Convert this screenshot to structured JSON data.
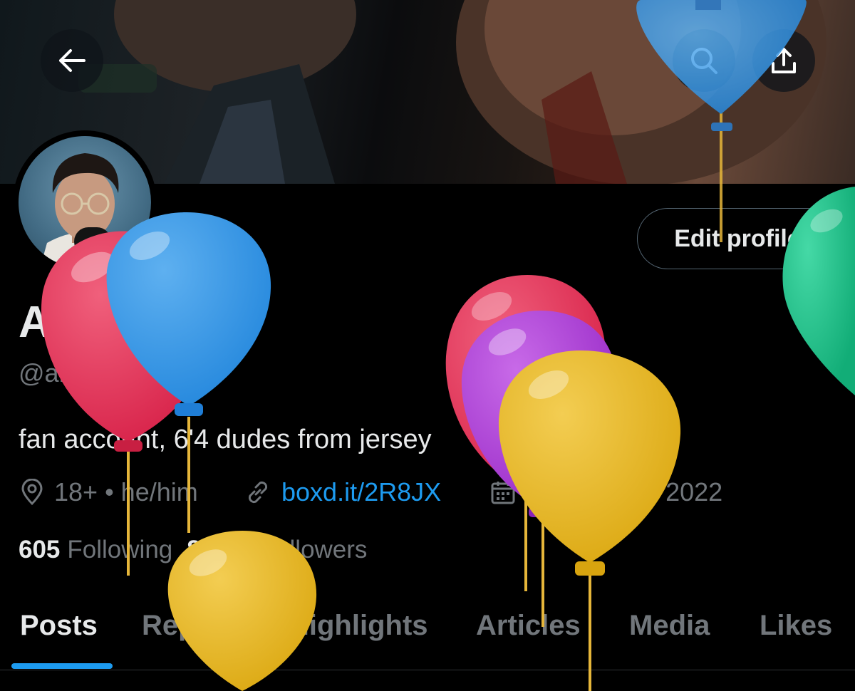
{
  "header": {
    "back_icon": "arrow-left-icon",
    "search_icon": "search-icon",
    "share_icon": "share-icon"
  },
  "profile": {
    "display_name": "Anti",
    "handle": "@antipike",
    "edit_button_label": "Edit profile",
    "bio": "fan account, 6'4 dudes from jersey",
    "location": "18+ • he/him",
    "website": "boxd.it/2R8JX",
    "joined": "Joined April 2022"
  },
  "stats": {
    "following_count": "605",
    "following_label": "Following",
    "followers_count": "82.9K",
    "followers_label": "Followers"
  },
  "tabs": [
    {
      "label": "Posts",
      "active": true
    },
    {
      "label": "Replies",
      "active": false
    },
    {
      "label": "Highlights",
      "active": false
    },
    {
      "label": "Articles",
      "active": false
    },
    {
      "label": "Media",
      "active": false
    },
    {
      "label": "Likes",
      "active": false
    }
  ],
  "colors": {
    "accent": "#1d9bf0",
    "text_primary": "#e7e9ea",
    "text_secondary": "#71767b",
    "background": "#000000",
    "balloon_red": "#e8395f",
    "balloon_blue": "#3b9be6",
    "balloon_purple": "#b03fd8",
    "balloon_yellow": "#e9b92b",
    "balloon_green": "#1fc38d"
  }
}
